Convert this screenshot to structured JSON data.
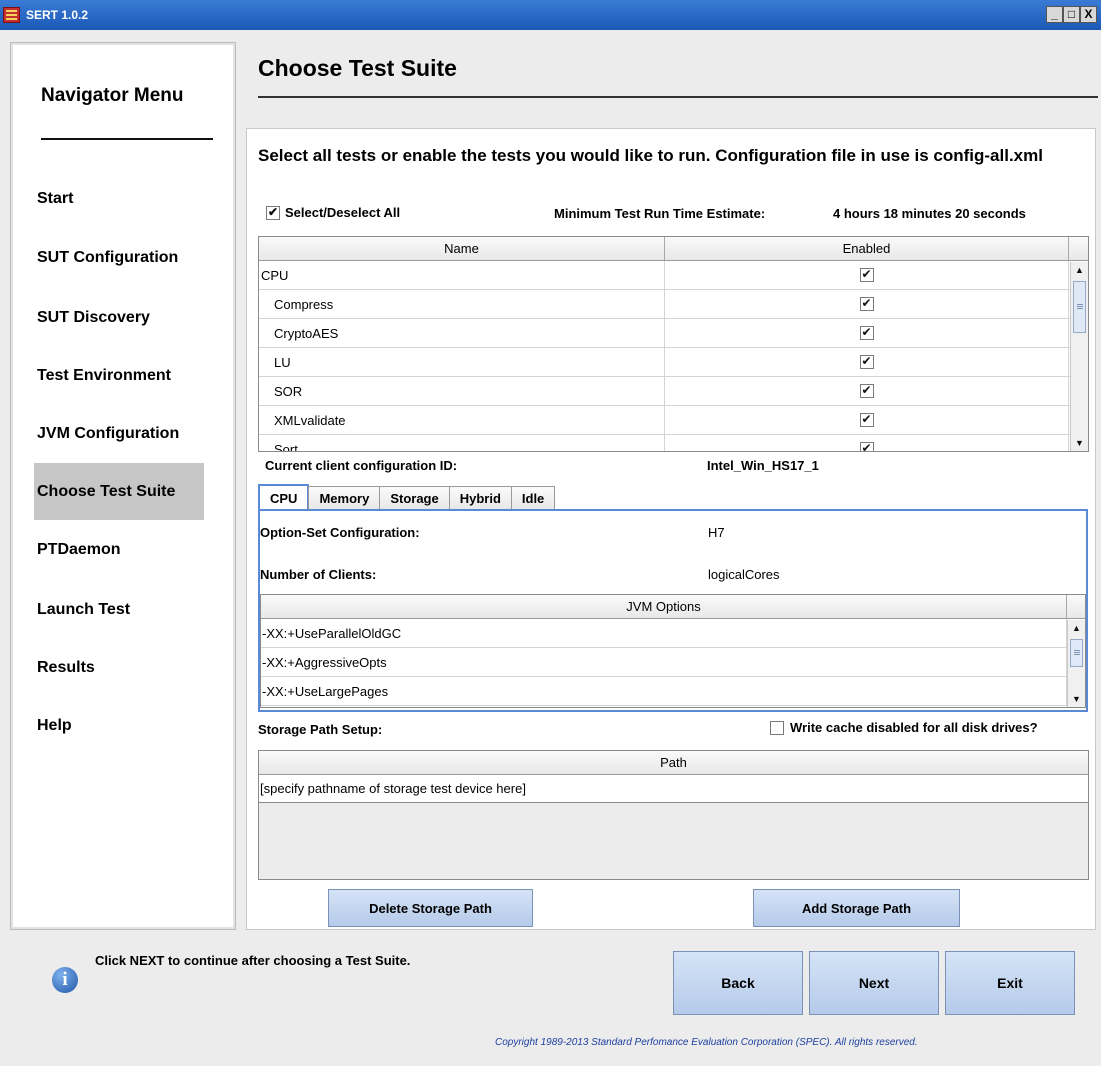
{
  "window": {
    "title": "SERT 1.0.2",
    "minimize": "_",
    "maximize": "□",
    "close": "X"
  },
  "nav": {
    "title": "Navigator Menu",
    "items": [
      {
        "label": "Start"
      },
      {
        "label": "SUT Configuration"
      },
      {
        "label": "SUT Discovery"
      },
      {
        "label": "Test Environment"
      },
      {
        "label": "JVM Configuration"
      },
      {
        "label": "Choose Test Suite",
        "active": true
      },
      {
        "label": "PTDaemon"
      },
      {
        "label": "Launch Test"
      },
      {
        "label": "Results"
      },
      {
        "label": "Help"
      }
    ]
  },
  "page": {
    "title": "Choose Test Suite",
    "intro": "Select all tests or enable the tests you would like to run. Configuration file in use is config-all.xml",
    "select_all_label": "Select/Deselect All",
    "estimate_label": "Minimum Test Run Time Estimate:",
    "estimate_value": "4 hours 18 minutes 20 seconds"
  },
  "tests_table": {
    "columns": [
      "Name",
      "Enabled"
    ],
    "rows": [
      {
        "name": "CPU",
        "enabled": true,
        "level": 0
      },
      {
        "name": "Compress",
        "enabled": true,
        "level": 1
      },
      {
        "name": "CryptoAES",
        "enabled": true,
        "level": 1
      },
      {
        "name": "LU",
        "enabled": true,
        "level": 1
      },
      {
        "name": "SOR",
        "enabled": true,
        "level": 1
      },
      {
        "name": "XMLvalidate",
        "enabled": true,
        "level": 1
      },
      {
        "name": "Sort",
        "enabled": true,
        "level": 1
      }
    ]
  },
  "client": {
    "label": "Current client configuration ID:",
    "value": "Intel_Win_HS17_1"
  },
  "tabs": [
    {
      "label": "CPU",
      "active": true
    },
    {
      "label": "Memory"
    },
    {
      "label": "Storage"
    },
    {
      "label": "Hybrid"
    },
    {
      "label": "Idle"
    }
  ],
  "cpu_tab": {
    "option_set_label": "Option-Set Configuration:",
    "option_set_value": "H7",
    "clients_label": "Number of Clients:",
    "clients_value": "logicalCores",
    "jvm_header": "JVM Options",
    "jvm_options": [
      "-XX:+UseParallelOldGC",
      "-XX:+AggressiveOpts",
      "-XX:+UseLargePages"
    ]
  },
  "storage": {
    "label": "Storage Path Setup:",
    "write_cache_label": "Write cache disabled for all disk drives?",
    "write_cache_checked": false,
    "path_header": "Path",
    "paths": [
      "[specify pathname of storage test device here]"
    ],
    "delete_button": "Delete Storage Path",
    "add_button": "Add Storage Path"
  },
  "footer": {
    "hint": "Click NEXT to continue after choosing a Test Suite.",
    "back": "Back",
    "next": "Next",
    "exit": "Exit",
    "copyright": "Copyright 1989-2013 Standard Perfomance Evaluation Corporation (SPEC). All rights reserved."
  }
}
